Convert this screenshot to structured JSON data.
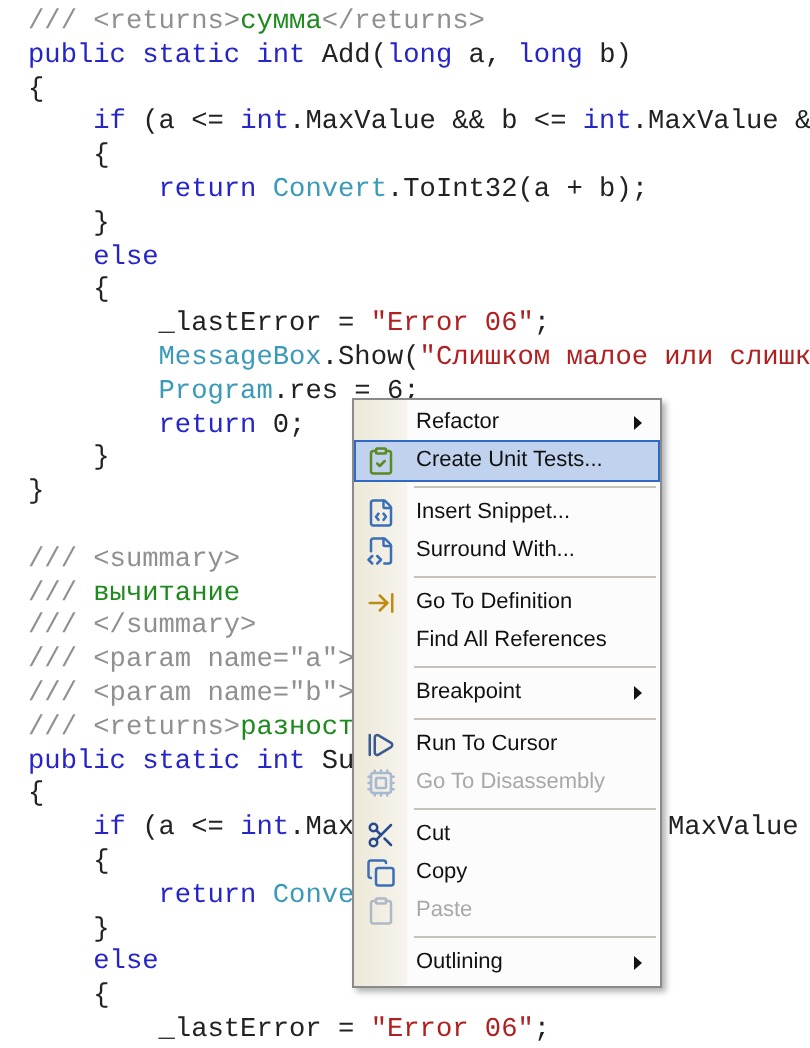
{
  "code_blocks": [
    [
      [
        {
          "text": "/// <returns>",
          "kind": "comment"
        },
        {
          "text": "сумма",
          "kind": "doc"
        },
        {
          "text": "</returns>",
          "kind": "comment"
        }
      ],
      [
        {
          "text": "public static int",
          "kind": "keyword"
        },
        {
          "text": " Add(",
          "kind": "plain"
        },
        {
          "text": "long",
          "kind": "keyword"
        },
        {
          "text": " a, ",
          "kind": "plain"
        },
        {
          "text": "long",
          "kind": "keyword"
        },
        {
          "text": " b)",
          "kind": "plain"
        }
      ],
      [
        {
          "text": "{",
          "kind": "plain"
        }
      ],
      [
        {
          "text": "    if",
          "kind": "keyword"
        },
        {
          "text": " (a <= ",
          "kind": "plain"
        },
        {
          "text": "int",
          "kind": "keyword"
        },
        {
          "text": ".MaxValue && b <= ",
          "kind": "plain"
        },
        {
          "text": "int",
          "kind": "keyword"
        },
        {
          "text": ".MaxValue &",
          "kind": "plain"
        }
      ],
      [
        {
          "text": "    {",
          "kind": "plain"
        }
      ],
      [
        {
          "text": "        return",
          "kind": "keyword"
        },
        {
          "text": " Convert",
          "kind": "type"
        },
        {
          "text": ".ToInt32(a + b);",
          "kind": "plain"
        }
      ],
      [
        {
          "text": "    }",
          "kind": "plain"
        }
      ],
      [
        {
          "text": "    else",
          "kind": "keyword"
        }
      ],
      [
        {
          "text": "    {",
          "kind": "plain"
        }
      ],
      [
        {
          "text": "        _lastError = ",
          "kind": "plain"
        },
        {
          "text": "\"Error 06\"",
          "kind": "string"
        },
        {
          "text": ";",
          "kind": "plain"
        }
      ],
      [
        {
          "text": "        MessageBox",
          "kind": "type"
        },
        {
          "text": ".Show(",
          "kind": "plain"
        },
        {
          "text": "\"Слишком малое или слишк",
          "kind": "string"
        }
      ],
      [
        {
          "text": "        Program",
          "kind": "type"
        },
        {
          "text": ".res = 6;",
          "kind": "plain"
        }
      ],
      [
        {
          "text": "        return",
          "kind": "keyword"
        },
        {
          "text": " 0;",
          "kind": "plain"
        }
      ],
      [
        {
          "text": "    }",
          "kind": "plain"
        }
      ],
      [
        {
          "text": "}",
          "kind": "plain"
        }
      ]
    ],
    [
      [
        {
          "text": "/// <summary>",
          "kind": "comment"
        }
      ],
      [
        {
          "text": "/// ",
          "kind": "comment"
        },
        {
          "text": "вычитание",
          "kind": "doc"
        }
      ],
      [
        {
          "text": "/// </summary>",
          "kind": "comment"
        }
      ],
      [
        {
          "text": "/// <param name=\"a\">",
          "kind": "comment"
        }
      ],
      [
        {
          "text": "/// <param name=\"b\">",
          "kind": "comment"
        }
      ],
      [
        {
          "text": "/// <returns>",
          "kind": "comment"
        },
        {
          "text": "разност",
          "kind": "doc"
        }
      ],
      [
        {
          "text": "public static int",
          "kind": "keyword"
        },
        {
          "text": " Su",
          "kind": "plain"
        }
      ],
      [
        {
          "text": "{",
          "kind": "plain"
        }
      ],
      [
        {
          "text": "    if",
          "kind": "keyword"
        },
        {
          "text": " (a <= ",
          "kind": "plain"
        },
        {
          "text": "int",
          "kind": "keyword"
        },
        {
          "text": ".Max",
          "kind": "plain"
        },
        {
          "text": "MaxValue",
          "kind": "past_menu"
        }
      ],
      [
        {
          "text": "    {",
          "kind": "plain"
        }
      ],
      [
        {
          "text": "        return",
          "kind": "keyword"
        },
        {
          "text": " Conve",
          "kind": "type"
        }
      ],
      [
        {
          "text": "    }",
          "kind": "plain"
        }
      ],
      [
        {
          "text": "    else",
          "kind": "keyword"
        }
      ],
      [
        {
          "text": "    {",
          "kind": "plain"
        }
      ],
      [
        {
          "text": "        _lastError = ",
          "kind": "plain"
        },
        {
          "text": "\"Error 06\"",
          "kind": "string"
        },
        {
          "text": ";",
          "kind": "plain"
        }
      ]
    ]
  ],
  "context_menu": [
    {
      "kind": "item",
      "label": "Refactor",
      "submenu": true,
      "disabled": false,
      "selected": false
    },
    {
      "kind": "item",
      "label": "Create Unit Tests...",
      "submenu": false,
      "disabled": false,
      "selected": true
    },
    {
      "kind": "separator"
    },
    {
      "kind": "item",
      "label": "Insert Snippet...",
      "submenu": false,
      "disabled": false,
      "selected": false
    },
    {
      "kind": "item",
      "label": "Surround With...",
      "submenu": false,
      "disabled": false,
      "selected": false
    },
    {
      "kind": "separator"
    },
    {
      "kind": "item",
      "label": "Go To Definition",
      "submenu": false,
      "disabled": false,
      "selected": false
    },
    {
      "kind": "item",
      "label": "Find All References",
      "submenu": false,
      "disabled": false,
      "selected": false
    },
    {
      "kind": "separator"
    },
    {
      "kind": "item",
      "label": "Breakpoint",
      "submenu": true,
      "disabled": false,
      "selected": false
    },
    {
      "kind": "separator"
    },
    {
      "kind": "item",
      "label": "Run To Cursor",
      "submenu": false,
      "disabled": false,
      "selected": false
    },
    {
      "kind": "item",
      "label": "Go To Disassembly",
      "submenu": false,
      "disabled": true,
      "selected": false
    },
    {
      "kind": "separator"
    },
    {
      "kind": "item",
      "label": "Cut",
      "submenu": false,
      "disabled": false,
      "selected": false
    },
    {
      "kind": "item",
      "label": "Copy",
      "submenu": false,
      "disabled": false,
      "selected": false
    },
    {
      "kind": "item",
      "label": "Paste",
      "submenu": false,
      "disabled": true,
      "selected": false
    },
    {
      "kind": "separator"
    },
    {
      "kind": "item",
      "label": "Outlining",
      "submenu": true,
      "disabled": false,
      "selected": false
    }
  ]
}
